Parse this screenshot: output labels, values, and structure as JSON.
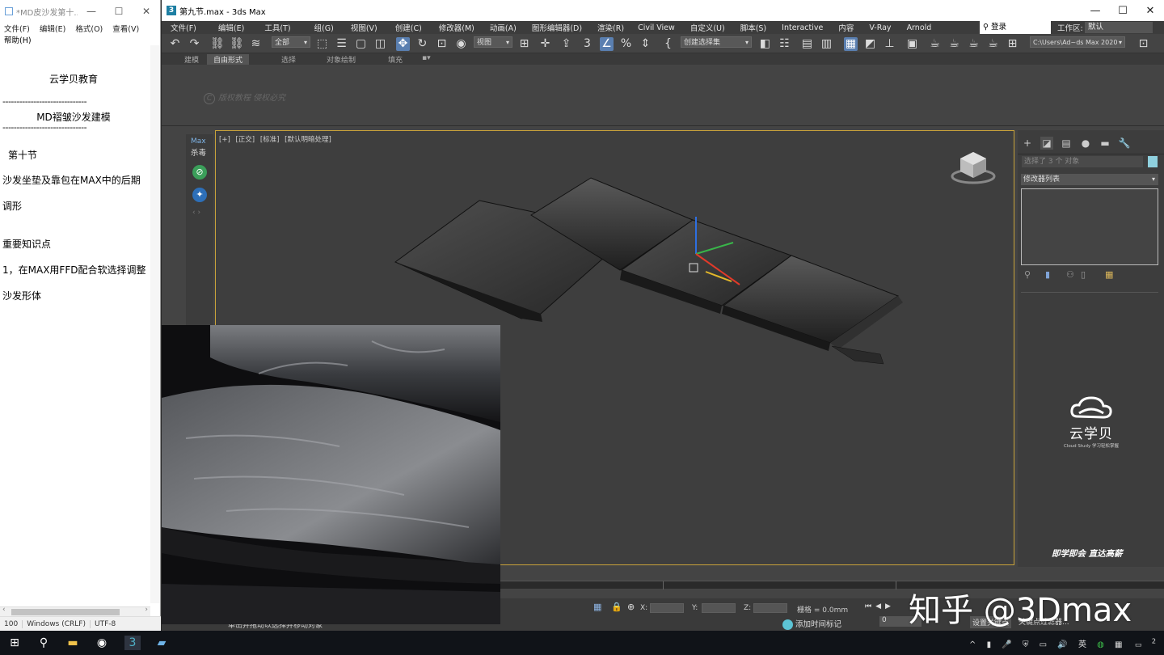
{
  "notepad": {
    "title": "*MD皮沙发第十...",
    "menu": [
      "文件(F)",
      "编辑(E)",
      "格式(O)",
      "查看(V)"
    ],
    "menu_help": "帮助(H)",
    "lines": {
      "org": "云学贝教育",
      "dash": "------------------------------",
      "heading": "MD褶皱沙发建模",
      "section": "第十节",
      "title1": "沙发坐垫及靠包在MAX中的后期",
      "title2": "调形",
      "key": "重要知识点",
      "point1": "1，在MAX用FFD配合软选择调整",
      "point1b": "沙发形体"
    },
    "status": [
      "100",
      "Windows (CRLF)",
      "UTF-8"
    ]
  },
  "max": {
    "title": "第九节.max - 3ds Max",
    "menus": [
      "文件(F)",
      "编辑(E)",
      "工具(T)",
      "组(G)",
      "视图(V)",
      "创建(C)",
      "修改器(M)",
      "动画(A)",
      "图形编辑器(D)",
      "渲染(R)",
      "Civil View",
      "自定义(U)",
      "脚本(S)",
      "Interactive",
      "内容",
      "V-Ray",
      "Arnold"
    ],
    "login": "登录",
    "workspace_label": "工作区:",
    "workspace_value": "默认",
    "toolbar": {
      "filter": "全部",
      "view": "视图",
      "selection_set": "创建选择集",
      "path": "C:\\Users\\Ad~ds Max 2020"
    },
    "ribbon_tabs": [
      "建模",
      "自由形式",
      "选择",
      "对象绘制",
      "填充"
    ],
    "watermark": "版权教程 侵权必究",
    "strip": {
      "max": "Max",
      "kill": "杀毒"
    },
    "viewport_label": [
      "[+]",
      "[正交]",
      "[标准]",
      "[默认明暗处理]"
    ],
    "command_panel": {
      "selection": "选择了 3 个 对象",
      "modifier_list": "修改器列表"
    },
    "brand": {
      "name": "云学贝",
      "sub": "Cloud Study 学习轻松掌握",
      "slogan": "即学即会  直达高薪"
    },
    "status": {
      "x_label": "X:",
      "y_label": "Y:",
      "z_label": "Z:",
      "grid": "栅格 = 0.0mm",
      "hint": "单击并拖动以选择并移动对象",
      "add_tag": "添加时间标记",
      "frame": "0",
      "set_key": "设置关键点",
      "key_filter": "关键点过滤器..."
    }
  },
  "overlay_watermark": "知乎 @3Dmax",
  "taskbar": {
    "lang": "英",
    "badge": "2"
  },
  "colors": {
    "viewport_border": "#c8a23a",
    "accent": "#5a7fb0",
    "cloud": "#5cc3d4"
  }
}
